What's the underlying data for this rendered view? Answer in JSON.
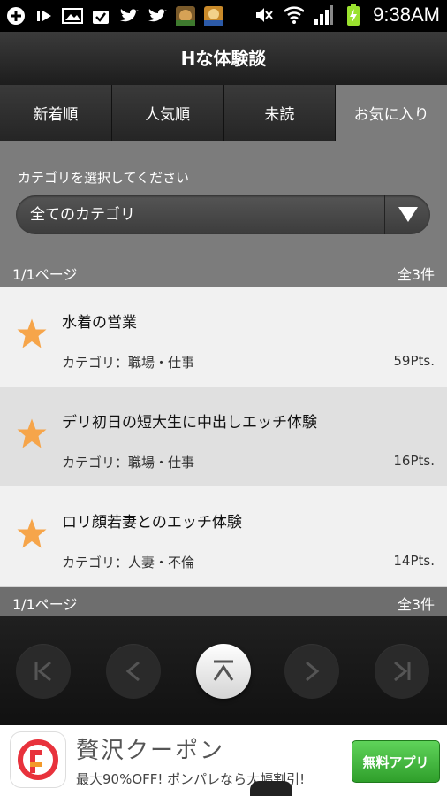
{
  "status_bar": {
    "time": "9:38AM",
    "left_icons": [
      "plus-icon",
      "play-icon",
      "image-icon",
      "bag-check-icon",
      "twitter-icon",
      "twitter-icon",
      "game-app-icon",
      "game-app-icon"
    ],
    "right_icons": [
      "mute-icon",
      "wifi-icon",
      "signal-icon",
      "battery-icon"
    ]
  },
  "title_bar": {
    "title": "Hな体験談"
  },
  "tabs": [
    {
      "label": "新着順",
      "active": false
    },
    {
      "label": "人気順",
      "active": false
    },
    {
      "label": "未読",
      "active": false
    },
    {
      "label": "お気に入り",
      "active": true
    }
  ],
  "category": {
    "prompt": "カテゴリを選択してください",
    "selected": "全てのカテゴリ"
  },
  "pager": {
    "page": "1/1ページ",
    "total": "全3件"
  },
  "items": [
    {
      "title": "水着の営業",
      "category": "カテゴリ：職場・仕事",
      "points": "59Pts."
    },
    {
      "title": "デリ初日の短大生に中出しエッチ体験",
      "category": "カテゴリ：職場・仕事",
      "points": "16Pts."
    },
    {
      "title": "ロリ顔若妻とのエッチ体験",
      "category": "カテゴリ：人妻・不倫",
      "points": "14Pts."
    }
  ],
  "nav": {
    "buttons": [
      "first-page-icon",
      "prev-page-icon",
      "scroll-top-icon",
      "next-page-icon",
      "last-page-icon"
    ]
  },
  "ad": {
    "title": "贅沢クーポン",
    "subtitle": "最大90%OFF! ポンパレなら大幅割引!",
    "button": "無料アプリ"
  },
  "colors": {
    "star": "#f6a54a",
    "active_tab": "#7c7c7c",
    "ad_button": "#3bb536"
  }
}
